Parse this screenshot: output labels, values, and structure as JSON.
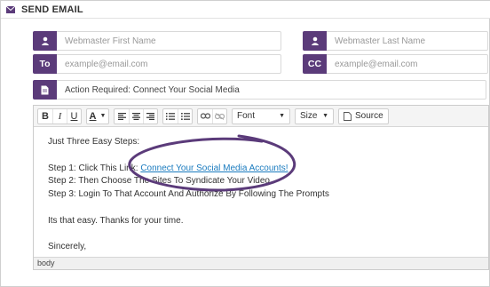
{
  "section": {
    "title": "SEND EMAIL"
  },
  "to_row": {
    "first_name_placeholder": "Webmaster First Name",
    "last_name_placeholder": "Webmaster Last Name"
  },
  "email_row": {
    "to_label": "To",
    "to_placeholder": "example@email.com",
    "cc_label": "CC",
    "cc_placeholder": "example@email.com"
  },
  "subject": {
    "value": "Action Required: Connect Your Social Media"
  },
  "toolbar": {
    "bold": "B",
    "italic": "I",
    "underline": "U",
    "text_color": "A",
    "font_label": "Font",
    "size_label": "Size",
    "source_label": "Source"
  },
  "body": {
    "intro": "Just Three Easy Steps:",
    "step1_prefix": "Step 1: Click This Link: ",
    "step1_link": "Connect Your Social Media Accounts!",
    "step2": "Step 2: Then Choose The Sites To Syndicate Your Video",
    "step3": "Step 3: Login To That Account And Authorize By Following The Prompts",
    "closing": "Its that easy. Thanks for your time.",
    "signoff": "Sincerely,"
  },
  "statusbar": {
    "path": "body"
  },
  "colors": {
    "accent": "#5b3b7a",
    "link": "#1a7bbf",
    "annotation": "#5b3b7a"
  }
}
